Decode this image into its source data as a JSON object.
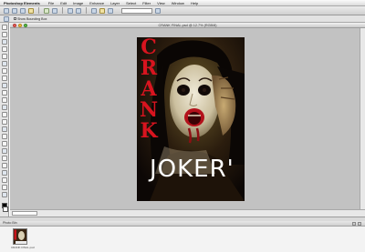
{
  "menubar": {
    "app_name": "Photoshop Elements",
    "items": [
      "File",
      "Edit",
      "Image",
      "Enhance",
      "Layer",
      "Select",
      "Filter",
      "View",
      "Window",
      "Help"
    ]
  },
  "options": {
    "items": [
      "Show Bounding Box"
    ]
  },
  "document": {
    "title": "CRANK FINAL.psd @ 12.7% (RGB/8)"
  },
  "poster": {
    "vertical_title": [
      "C",
      "R",
      "A",
      "N",
      "K"
    ],
    "main_title": "JOKER'",
    "accent_color": "#d8141f"
  },
  "bin": {
    "title": "Photo Bin",
    "thumb_label": "CRANK FINAL.psd"
  }
}
